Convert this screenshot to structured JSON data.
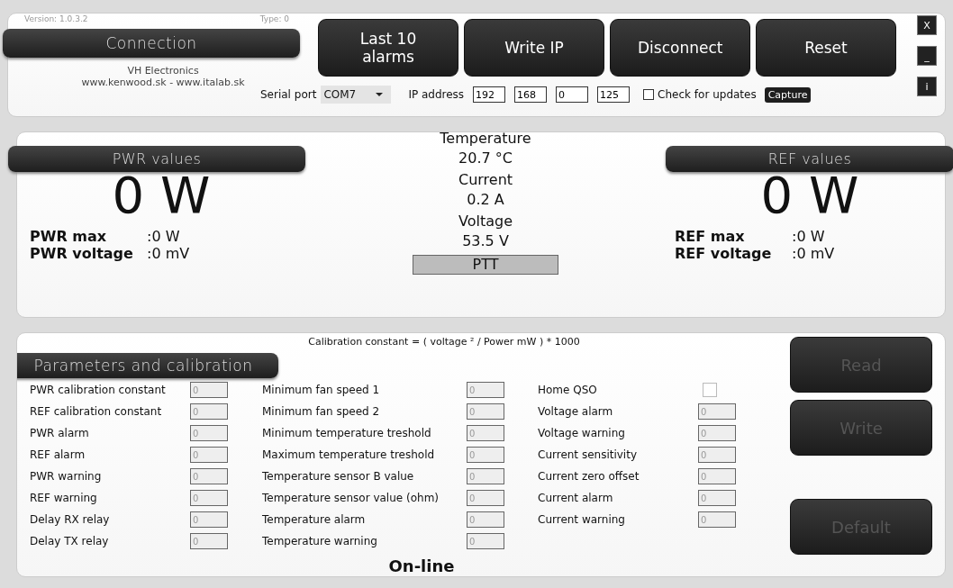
{
  "version": "Version: 1.0.3.2",
  "type": "Type: 0",
  "connection_header": "Connection",
  "toolbar_buttons": [
    "Last 10 alarms",
    "Write IP",
    "Disconnect",
    "Reset"
  ],
  "window_buttons": [
    "X",
    "_",
    "i"
  ],
  "company": "VH Electronics",
  "websites": "www.kenwood.sk - www.italab.sk",
  "serial_port": {
    "label": "Serial port",
    "value": "COM7"
  },
  "ip_address": {
    "label": "IP address",
    "octets": [
      "192",
      "168",
      "0",
      "125"
    ]
  },
  "check_updates": {
    "label": "Check for updates",
    "checked": false
  },
  "capture_button": "Capture",
  "pwr": {
    "header": "PWR values",
    "power": "0 W",
    "rows": [
      {
        "label": "PWR max",
        "value": ":0 W"
      },
      {
        "label": "PWR voltage",
        "value": ":0 mV"
      }
    ]
  },
  "readings": [
    {
      "label": "Temperature",
      "value": "20.7 °C"
    },
    {
      "label": "Current",
      "value": "0.2 A"
    },
    {
      "label": "Voltage",
      "value": "53.5 V"
    }
  ],
  "ptt": "PTT",
  "ref": {
    "header": "REF values",
    "power": "0 W",
    "rows": [
      {
        "label": "REF max",
        "value": ":0 W"
      },
      {
        "label": "REF voltage",
        "value": ":0 mV"
      }
    ]
  },
  "parameters": {
    "header": "Parameters and calibration",
    "formula": "Calibration constant = ( voltage ² / Power mW ) * 1000",
    "columns": [
      [
        {
          "kind": "input",
          "label": "PWR calibration constant",
          "value": "0"
        },
        {
          "kind": "input",
          "label": "REF calibration constant",
          "value": "0"
        },
        {
          "kind": "input",
          "label": "PWR alarm",
          "value": "0"
        },
        {
          "kind": "input",
          "label": "REF alarm",
          "value": "0"
        },
        {
          "kind": "input",
          "label": "PWR warning",
          "value": "0"
        },
        {
          "kind": "input",
          "label": "REF warning",
          "value": "0"
        },
        {
          "kind": "input",
          "label": "Delay RX relay",
          "value": "0"
        },
        {
          "kind": "input",
          "label": "Delay TX relay",
          "value": "0"
        }
      ],
      [
        {
          "kind": "input",
          "label": "Minimum fan speed 1",
          "value": "0"
        },
        {
          "kind": "input",
          "label": "Minimum fan speed 2",
          "value": "0"
        },
        {
          "kind": "input",
          "label": "Minimum temperature treshold",
          "value": "0"
        },
        {
          "kind": "input",
          "label": "Maximum temperature treshold",
          "value": "0"
        },
        {
          "kind": "input",
          "label": "Temperature sensor B value",
          "value": "0"
        },
        {
          "kind": "input",
          "label": "Temperature sensor value (ohm)",
          "value": "0"
        },
        {
          "kind": "input",
          "label": "Temperature alarm",
          "value": "0"
        },
        {
          "kind": "input",
          "label": "Temperature warning",
          "value": "0"
        }
      ],
      [
        {
          "kind": "checkbox",
          "label": "Home QSO",
          "checked": false
        },
        {
          "kind": "input",
          "label": "Voltage alarm",
          "value": "0"
        },
        {
          "kind": "input",
          "label": "Voltage warning",
          "value": "0"
        },
        {
          "kind": "input",
          "label": "Current sensitivity",
          "value": "0"
        },
        {
          "kind": "input",
          "label": "Current zero offset",
          "value": "0"
        },
        {
          "kind": "input",
          "label": "Current alarm",
          "value": "0"
        },
        {
          "kind": "input",
          "label": "Current warning",
          "value": "0"
        }
      ]
    ],
    "buttons": [
      {
        "label": "Read",
        "disabled": true
      },
      {
        "label": "Write",
        "disabled": true
      },
      {
        "label": "Default",
        "disabled": true
      }
    ]
  },
  "status": "On-line"
}
